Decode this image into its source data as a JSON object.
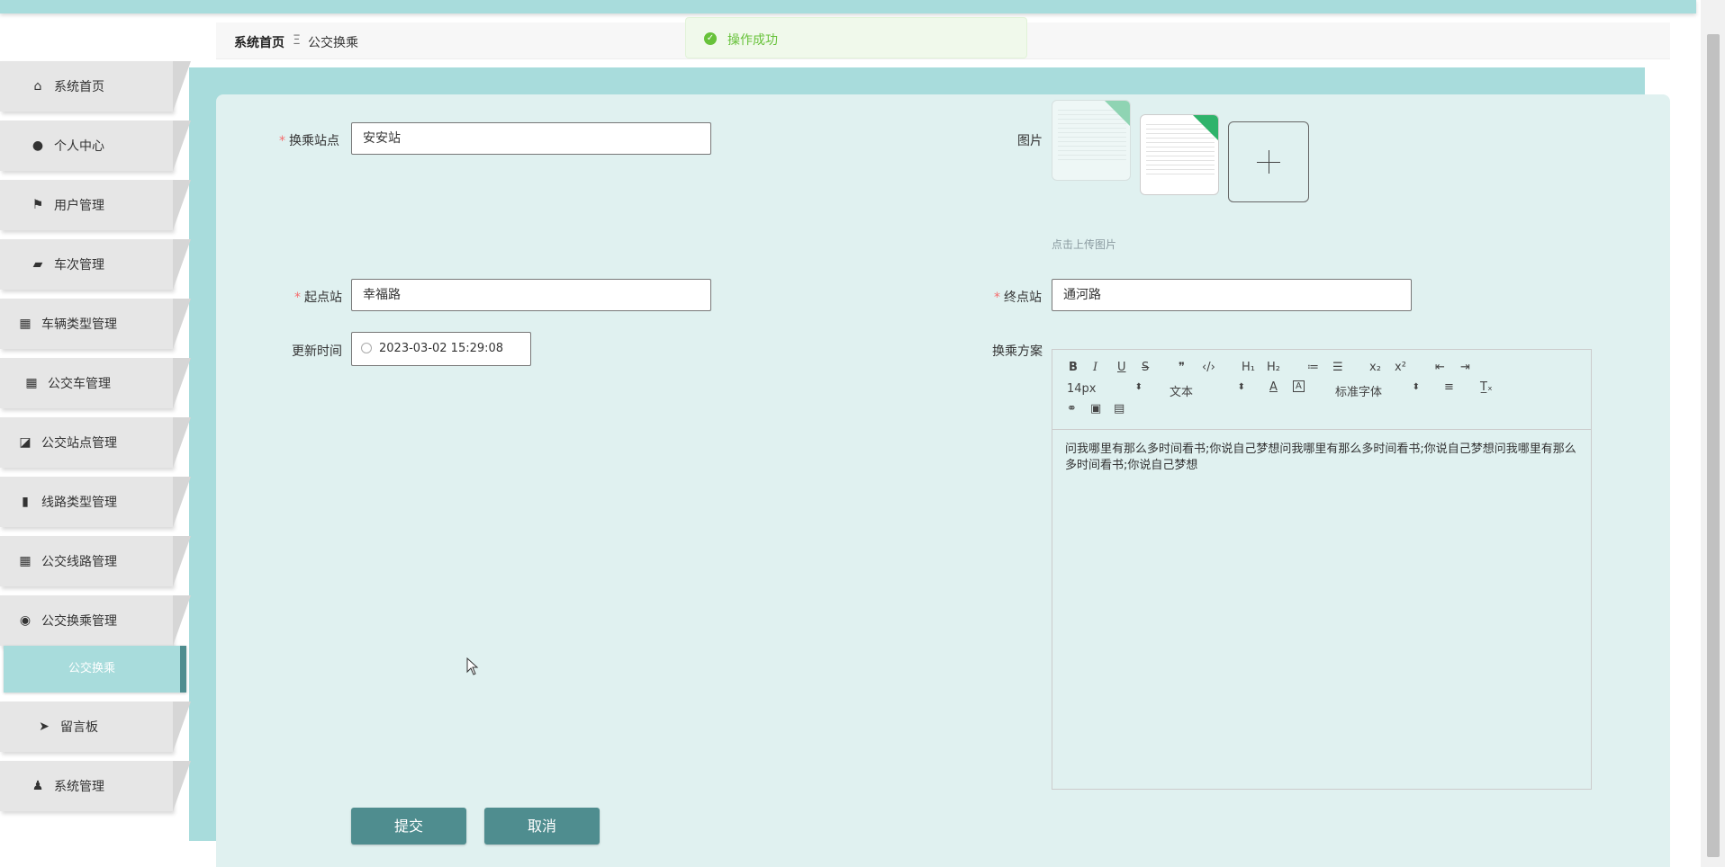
{
  "breadcrumb": {
    "home": "系统首页",
    "separator": "Ξ",
    "current": "公交换乘"
  },
  "toast": {
    "message": "操作成功"
  },
  "sidebar": {
    "items": [
      {
        "label": "系统首页",
        "icon": "home-icon"
      },
      {
        "label": "个人中心",
        "icon": "user-icon"
      },
      {
        "label": "用户管理",
        "icon": "flag-icon"
      },
      {
        "label": "车次管理",
        "icon": "briefcase-icon"
      },
      {
        "label": "车辆类型管理",
        "icon": "grid-icon"
      },
      {
        "label": "公交车管理",
        "icon": "grid-icon"
      },
      {
        "label": "公交站点管理",
        "icon": "chart-icon"
      },
      {
        "label": "线路类型管理",
        "icon": "paint-roller-icon"
      },
      {
        "label": "公交线路管理",
        "icon": "grid-icon"
      },
      {
        "label": "公交换乘管理",
        "icon": "location-icon"
      },
      {
        "label": "留言板",
        "icon": "send-icon"
      },
      {
        "label": "系统管理",
        "icon": "person-icon"
      }
    ],
    "active_sub": "公交换乘"
  },
  "form": {
    "transfer_station_label": "换乘站点",
    "transfer_station_value": "安安站",
    "image_label": "图片",
    "upload_hint": "点击上传图片",
    "start_label": "起点站",
    "start_value": "幸福路",
    "end_label": "终点站",
    "end_value": "通河路",
    "update_time_label": "更新时间",
    "update_time_value": "2023-03-02 15:29:08",
    "plan_label": "换乘方案",
    "plan_content": "问我哪里有那么多时间看书;你说自己梦想问我哪里有那么多时间看书;你说自己梦想问我哪里有那么多时间看书;你说自己梦想",
    "submit_label": "提交",
    "cancel_label": "取消"
  },
  "editor_toolbar": {
    "bold": "B",
    "italic": "I",
    "underline": "U",
    "strike": "S",
    "quote": "❞",
    "code": "‹/›",
    "h1": "H₁",
    "h2": "H₂",
    "ordered": "≔",
    "bullet": "☰",
    "sub": "x₂",
    "sup": "x²",
    "outdent": "⇤",
    "indent": "⇥",
    "size_value": "14px",
    "header_value": "文本",
    "font_value": "标准字体",
    "align": "≡",
    "clean": "T̲ₓ",
    "link": "⚭",
    "image": "▣",
    "video": "▤"
  },
  "colors": {
    "accent": "#a8dcdc",
    "button": "#4f8d8f",
    "card": "#e0f1f0",
    "success": "#67c23a",
    "required": "#f56c6c"
  }
}
